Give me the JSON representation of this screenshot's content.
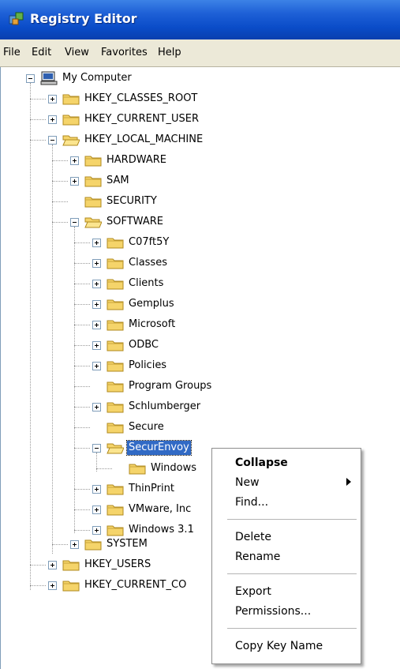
{
  "window": {
    "title": "Registry Editor",
    "icon": "regedit-icon"
  },
  "menubar": [
    "File",
    "Edit",
    "View",
    "Favorites",
    "Help"
  ],
  "tree": {
    "root": "My Computer",
    "hives": {
      "classes_root": "HKEY_CLASSES_ROOT",
      "current_user": "HKEY_CURRENT_USER",
      "local_machine": "HKEY_LOCAL_MACHINE",
      "users": "HKEY_USERS",
      "current_config": "HKEY_CURRENT_CO"
    },
    "hklm": {
      "hardware": "HARDWARE",
      "sam": "SAM",
      "security": "SECURITY",
      "software": "SOFTWARE",
      "system": "SYSTEM"
    },
    "software": {
      "c07ft5y": "C07ft5Y",
      "classes": "Classes",
      "clients": "Clients",
      "gemplus": "Gemplus",
      "microsoft": "Microsoft",
      "odbc": "ODBC",
      "policies": "Policies",
      "program_groups": "Program Groups",
      "schlumberger": "Schlumberger",
      "secure": "Secure",
      "securenvoy": "SecurEnvoy",
      "thinprint": "ThinPrint",
      "vmware": "VMware, Inc",
      "windows31": "Windows 3.1"
    },
    "securenvoy": {
      "windows": "Windows"
    },
    "selected": "SecurEnvoy"
  },
  "context_menu": {
    "collapse": "Collapse",
    "new": "New",
    "find": "Find...",
    "delete": "Delete",
    "rename": "Rename",
    "export": "Export",
    "permissions": "Permissions...",
    "copy_key_name": "Copy Key Name"
  },
  "colors": {
    "titlebar": "#0a4cc8",
    "menubar": "#ece9d8",
    "selection": "#316ac5",
    "folder": "#f5d46a"
  }
}
